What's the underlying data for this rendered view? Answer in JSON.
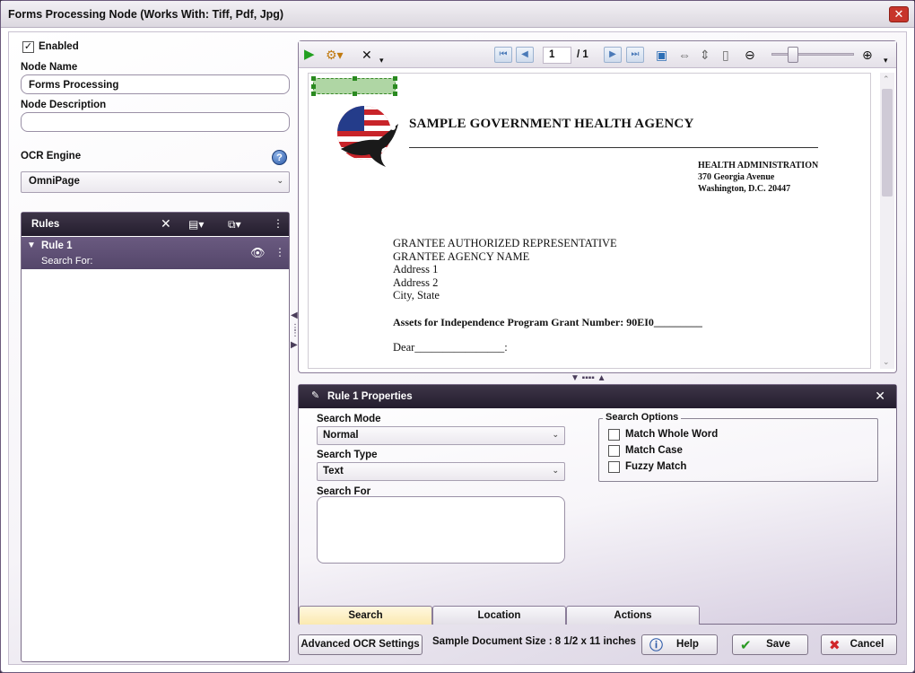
{
  "window": {
    "title": "Forms Processing Node    (Works With: Tiff, Pdf, Jpg)",
    "close_glyph": "✕"
  },
  "left": {
    "enabled_label": "Enabled",
    "enabled_checked": true,
    "node_name_label": "Node Name",
    "node_name_value": "Forms Processing",
    "node_description_label": "Node Description",
    "node_description_value": "",
    "ocr_engine_label": "OCR Engine",
    "ocr_engine_value": "OmniPage"
  },
  "rules": {
    "title": "Rules",
    "items": [
      {
        "name": "Rule 1",
        "sub": "Search For:"
      }
    ]
  },
  "viewer": {
    "page_current": "1",
    "page_total": "/ 1",
    "document": {
      "agency": "SAMPLE GOVERNMENT HEALTH AGENCY",
      "admin_lines": [
        "HEALTH ADMINISTRATION",
        "370 Georgia Avenue",
        "Washington, D.C. 20447"
      ],
      "address_lines": [
        "GRANTEE AUTHORIZED REPRESENTATIVE",
        "GRANTEE AGENCY NAME",
        "Address 1",
        "Address 2",
        "City, State"
      ],
      "assets_line": "Assets for Independence Program Grant Number:  90EI0_________",
      "dear_line": "Dear________________:"
    }
  },
  "properties": {
    "title": "Rule 1 Properties",
    "search_mode_label": "Search Mode",
    "search_mode_value": "Normal",
    "search_type_label": "Search Type",
    "search_type_value": "Text",
    "search_for_label": "Search For",
    "search_for_value": "",
    "options_title": "Search Options",
    "options": [
      {
        "label": "Match Whole Word",
        "checked": false
      },
      {
        "label": "Match Case",
        "checked": false
      },
      {
        "label": "Fuzzy Match",
        "checked": false
      }
    ],
    "tabs": [
      {
        "label": "Search",
        "active": true
      },
      {
        "label": "Location",
        "active": false
      },
      {
        "label": "Actions",
        "active": false
      }
    ]
  },
  "bottom": {
    "advanced_label": "Advanced OCR Settings",
    "sample_size": "Sample Document Size : 8 1/2 x 11 inches",
    "help_label": "Help",
    "save_label": "Save",
    "cancel_label": "Cancel"
  },
  "colors": {
    "accent": "#54466a",
    "header_dark": "#241d2e",
    "active_tab": "#fbe9b0",
    "selection_green": "#6eb45a"
  }
}
